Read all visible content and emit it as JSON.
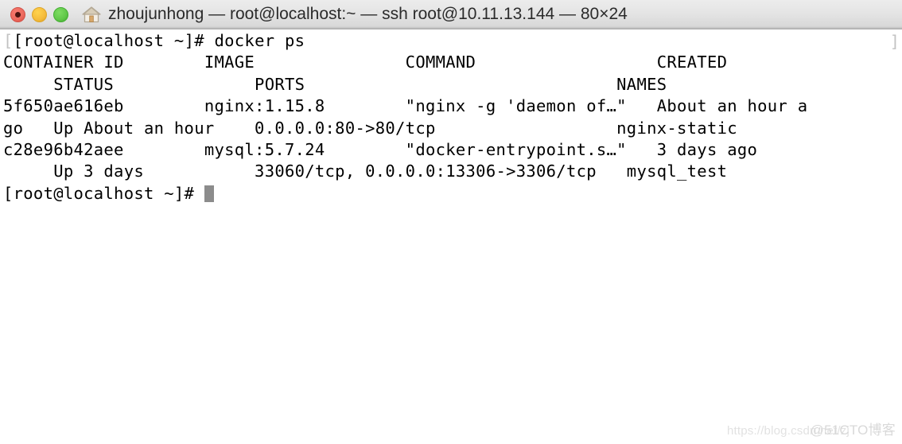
{
  "window": {
    "title": "zhoujunhong — root@localhost:~ — ssh root@10.11.13.144 — 80×24",
    "traffic_lights": {
      "close_color": "#ec6a5e",
      "minimize_color": "#f5bc3c",
      "maximize_color": "#61c84a"
    },
    "home_icon": "home-icon"
  },
  "terminal": {
    "columns": "80",
    "rows": "24",
    "background": "#ffffff",
    "foreground": "#000000",
    "cursor_color": "#8c8c8c",
    "ghost_char_left": "[",
    "ghost_char_right": "]",
    "lines": [
      "[root@localhost ~]# docker ps",
      "CONTAINER ID        IMAGE               COMMAND                  CREATED",
      "     STATUS              PORTS                               NAMES",
      "5f650ae616eb        nginx:1.15.8        \"nginx -g 'daemon of…\"   About an hour a",
      "go   Up About an hour    0.0.0.0:80->80/tcp                  nginx-static",
      "c28e96b42aee        mysql:5.7.24        \"docker-entrypoint.s…\"   3 days ago",
      "     Up 3 days           33060/tcp, 0.0.0.0:13306->3306/tcp   mysql_test",
      "[root@localhost ~]# "
    ],
    "command": "docker ps",
    "prompt": "[root@localhost ~]# ",
    "table": {
      "headers": [
        "CONTAINER ID",
        "IMAGE",
        "COMMAND",
        "CREATED",
        "STATUS",
        "PORTS",
        "NAMES"
      ],
      "rows": [
        {
          "container_id": "5f650ae616eb",
          "image": "nginx:1.15.8",
          "command": "\"nginx -g 'daemon of…\"",
          "created": "About an hour ago",
          "status": "Up About an hour",
          "ports": "0.0.0.0:80->80/tcp",
          "names": "nginx-static"
        },
        {
          "container_id": "c28e96b42aee",
          "image": "mysql:5.7.24",
          "command": "\"docker-entrypoint.s…\"",
          "created": "3 days ago",
          "status": "Up 3 days",
          "ports": "33060/tcp, 0.0.0.0:13306->3306/tcp",
          "names": "mysql_test"
        }
      ]
    }
  },
  "watermarks": {
    "csdn": "https://blog.csdn.net/zj",
    "cto": "@51CTO博客"
  }
}
